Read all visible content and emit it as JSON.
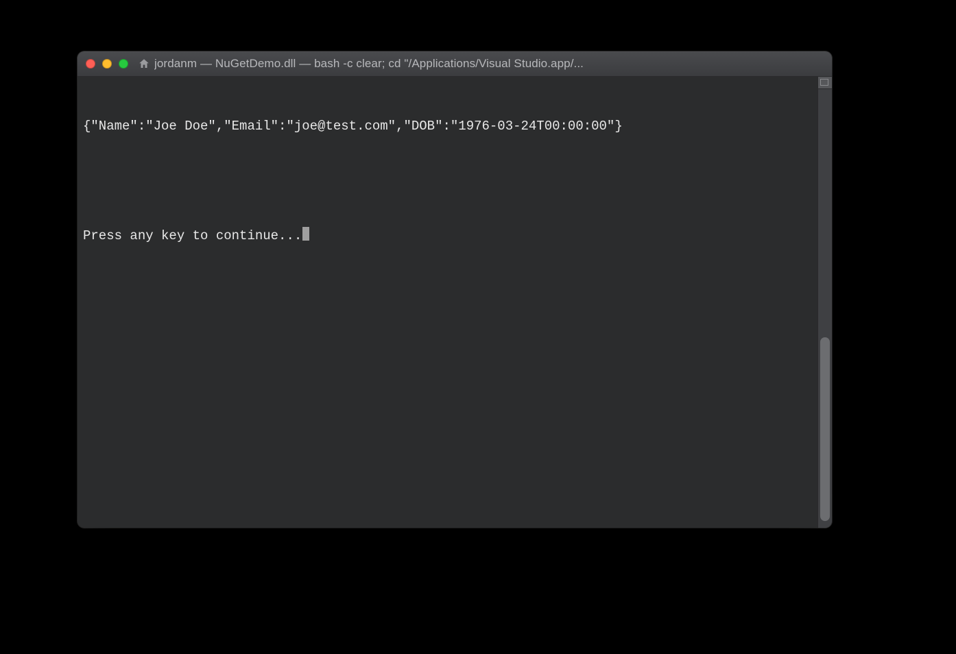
{
  "window": {
    "title": "jordanm — NuGetDemo.dll — bash -c clear; cd \"/Applications/Visual Studio.app/..."
  },
  "terminal": {
    "output_line": "{\"Name\":\"Joe Doe\",\"Email\":\"joe@test.com\",\"DOB\":\"1976-03-24T00:00:00\"}",
    "prompt_line": "Press any key to continue..."
  }
}
